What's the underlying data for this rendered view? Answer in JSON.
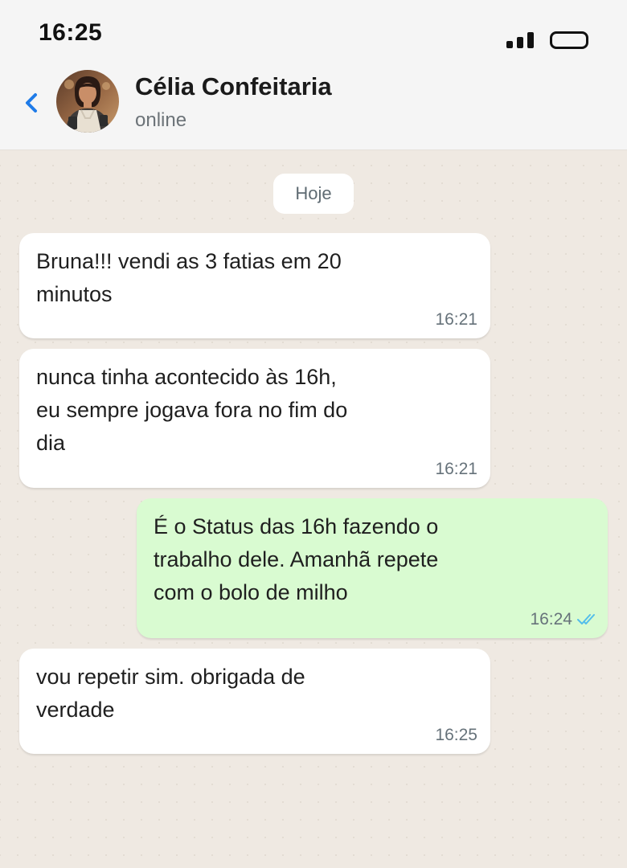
{
  "status_bar": {
    "time": "16:25"
  },
  "header": {
    "contact_name": "Célia Confeitaria",
    "contact_status": "online",
    "avatar_icon": "woman-avatar-icon",
    "back_icon": "chevron-left-icon"
  },
  "chat": {
    "date_label": "Hoje",
    "messages": [
      {
        "direction": "incoming",
        "text": "Bruna!!! vendi as 3 fatias em 20\nminutos",
        "time": "16:21"
      },
      {
        "direction": "incoming",
        "text": "nunca tinha acontecido às 16h,\neu sempre jogava fora no fim do\ndia",
        "time": "16:21"
      },
      {
        "direction": "outgoing",
        "text": "É o Status das 16h fazendo o\ntrabalho dele. Amanhã repete\ncom o bolo de milho",
        "time": "16:24",
        "read_receipt_icon": "double-check-icon"
      },
      {
        "direction": "incoming",
        "text": "vou repetir sim. obrigada de\nverdade",
        "time": "16:25"
      }
    ]
  },
  "colors": {
    "header_bg": "#f5f5f5",
    "chat_bg": "#efe9e2",
    "incoming_bubble": "#ffffff",
    "outgoing_bubble": "#d9fbd1",
    "accent_blue": "#1f7be8",
    "read_receipt": "#53bdeb"
  }
}
